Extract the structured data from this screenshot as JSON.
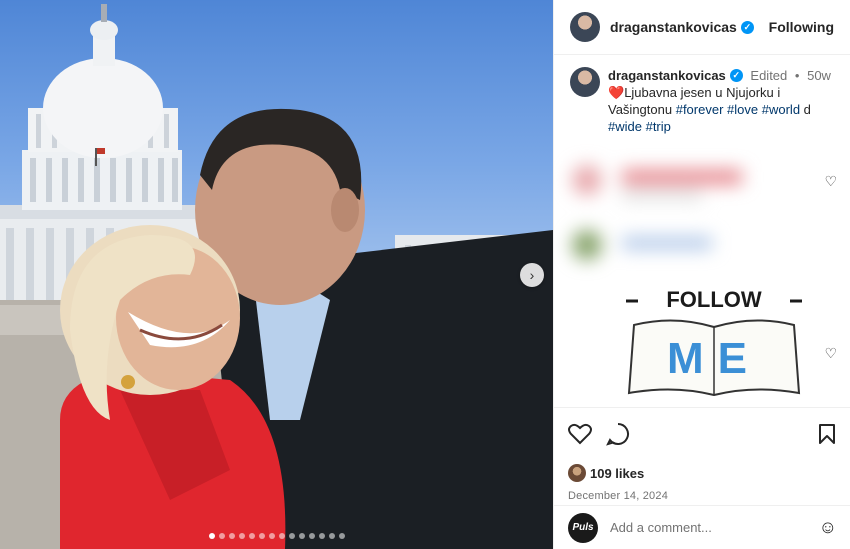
{
  "post": {
    "username": "draganstankovicas",
    "follow_state": "Following",
    "caption": {
      "edited": "Edited",
      "separator": "•",
      "age": "50w",
      "heart": "❤️",
      "text_part1": "Ljubavna jesen u Njujorku i Vašingtonu",
      "hashtags": [
        "#forever",
        "#love",
        "#world"
      ],
      "trailing": "d",
      "hashtags_line2": [
        "#wide",
        "#trip"
      ]
    },
    "likes": "109 likes",
    "date": "December 14, 2024",
    "carousel": {
      "total": 14,
      "active_index": 0
    },
    "sticker": {
      "line1": "FOLLOW",
      "line2": "ME"
    },
    "comment": {
      "placeholder": "Add a comment...",
      "commenter": "Puls"
    }
  },
  "icons": {
    "verified": "verified-badge-icon",
    "like": "heart-icon",
    "comment": "comment-icon",
    "bookmark": "bookmark-icon",
    "emoji": "emoji-icon",
    "next": "chevron-right-icon"
  },
  "colors": {
    "verified": "#0095f6",
    "hashtag": "#00376b",
    "heart": "#e0245e",
    "meta": "#737373"
  }
}
